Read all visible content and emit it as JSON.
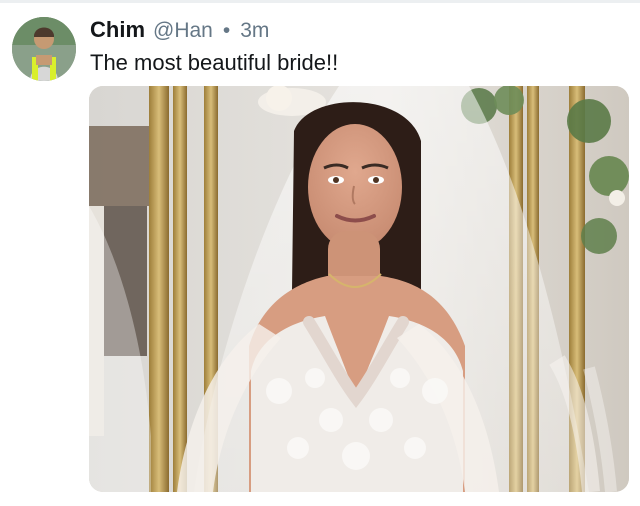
{
  "tweet": {
    "display_name": "Chim",
    "handle": "@Han",
    "separator": "•",
    "timestamp": "3m",
    "text": "The most beautiful bride!!"
  },
  "icons": {
    "avatar": "profile-avatar",
    "media": "tweet-photo"
  },
  "colors": {
    "name_text": "#14171a",
    "muted_text": "#657786",
    "divider": "#eceff1"
  }
}
